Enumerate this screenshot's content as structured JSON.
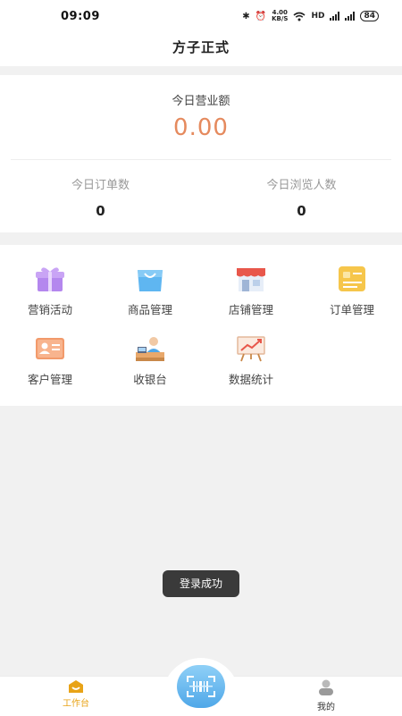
{
  "status_bar": {
    "time": "09:09",
    "net_speed_value": "4.00",
    "net_speed_unit": "KB/S",
    "hd_label": "HD",
    "battery": "84"
  },
  "header": {
    "title": "方子正式"
  },
  "stats": {
    "revenue_label": "今日营业额",
    "revenue_value": "0.00",
    "orders_label": "今日订单数",
    "orders_value": "0",
    "visitors_label": "今日浏览人数",
    "visitors_value": "0"
  },
  "menu": {
    "items": [
      {
        "label": "营销活动",
        "icon": "gift-icon"
      },
      {
        "label": "商品管理",
        "icon": "shopping-bag-icon"
      },
      {
        "label": "店铺管理",
        "icon": "store-icon"
      },
      {
        "label": "订单管理",
        "icon": "order-list-icon"
      },
      {
        "label": "客户管理",
        "icon": "customer-card-icon"
      },
      {
        "label": "收银台",
        "icon": "cashier-icon"
      },
      {
        "label": "数据统计",
        "icon": "chart-board-icon"
      }
    ]
  },
  "toast": {
    "text": "登录成功"
  },
  "tab_bar": {
    "workbench_label": "工作台",
    "mine_label": "我的",
    "accent_color": "#e8a317",
    "scan_icon": "scan-icon"
  },
  "colors": {
    "revenue": "#e58a5e",
    "background": "#f1f1f1"
  }
}
